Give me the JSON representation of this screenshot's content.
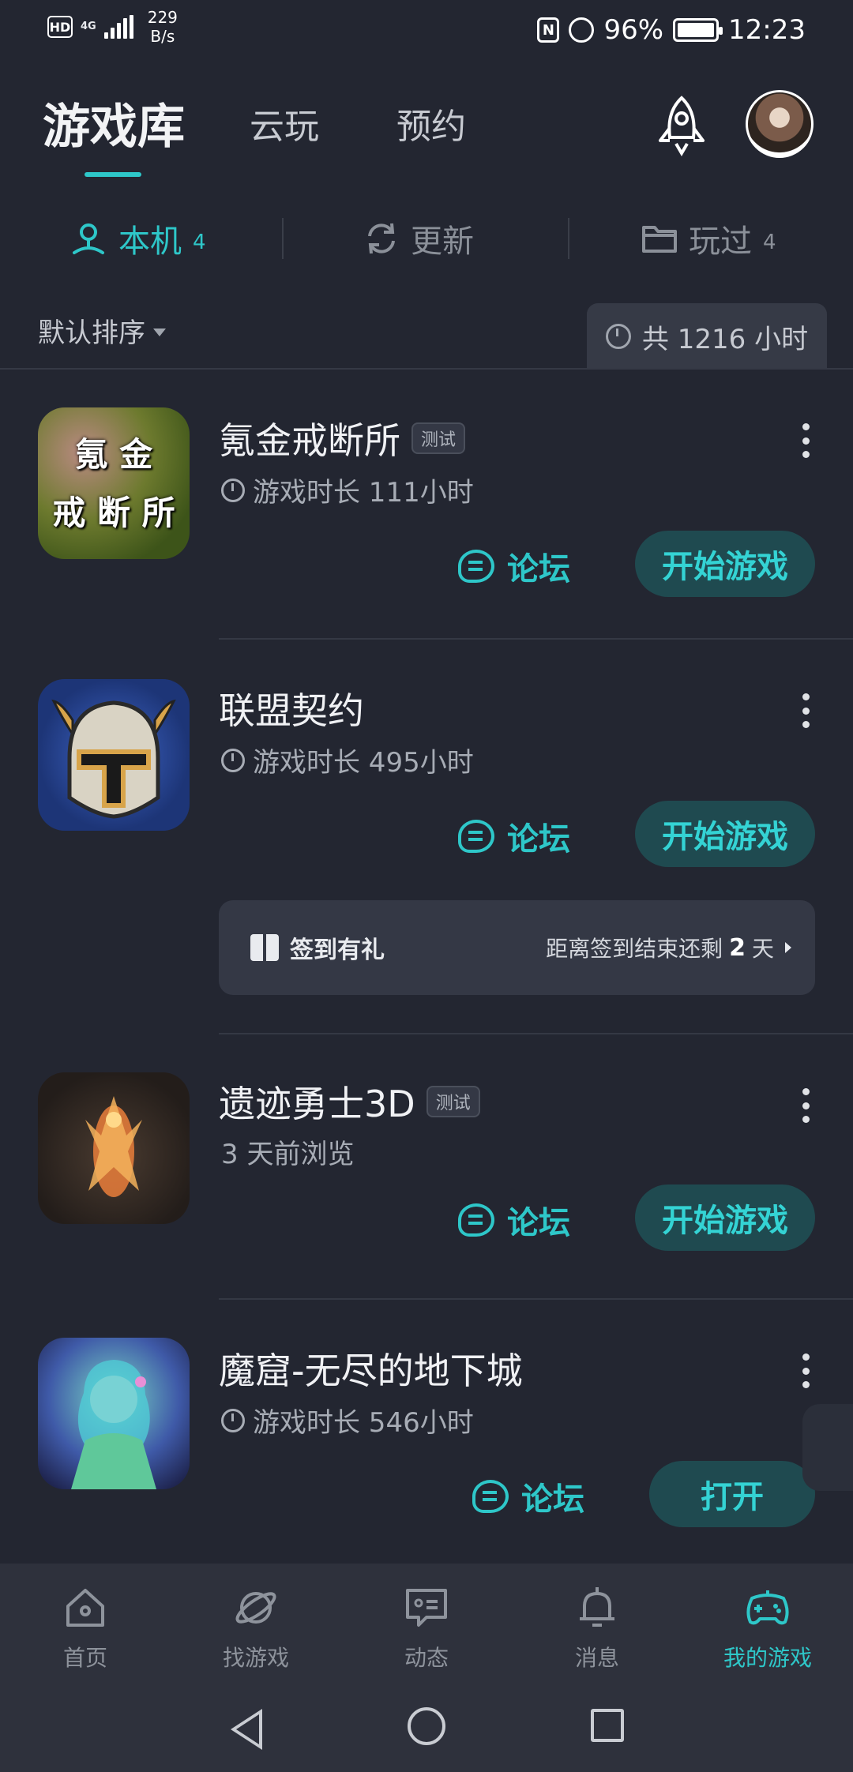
{
  "status_bar": {
    "hd": "HD",
    "network": "4G",
    "net_rate_value": "229",
    "net_rate_unit": "B/s",
    "battery": "96%",
    "time": "12:23"
  },
  "header": {
    "tabs": [
      {
        "label": "游戏库",
        "active": true
      },
      {
        "label": "云玩",
        "active": false
      },
      {
        "label": "预约",
        "active": false
      }
    ],
    "accent_color": "#2ec7c9"
  },
  "subtabs": [
    {
      "label": "本机",
      "count": "4",
      "active": true,
      "icon": "location-pin-icon"
    },
    {
      "label": "更新",
      "count": "",
      "active": false,
      "icon": "refresh-icon"
    },
    {
      "label": "玩过",
      "count": "4",
      "active": false,
      "icon": "folder-icon"
    }
  ],
  "sort": {
    "label": "默认排序"
  },
  "total_time": {
    "label": "共 1216 小时"
  },
  "games": [
    {
      "name": "氪金戒断所",
      "badge": "测试",
      "sub": "游戏时长 111小时",
      "forum": "论坛",
      "action": "开始游戏",
      "icon_text_1": "氪 金",
      "icon_text_2": "戒 断 所"
    },
    {
      "name": "联盟契约",
      "badge": "",
      "sub": "游戏时长 495小时",
      "forum": "论坛",
      "action": "开始游戏"
    },
    {
      "name": "遗迹勇士3D",
      "badge": "测试",
      "sub": "3 天前浏览",
      "forum": "论坛",
      "action": "开始游戏"
    },
    {
      "name": "魔窟-无尽的地下城",
      "badge": "",
      "sub": "游戏时长 546小时",
      "forum": "论坛",
      "action": "打开"
    }
  ],
  "gift_card": {
    "title": "签到有礼",
    "remaining_prefix": "距离签到结束还剩",
    "remaining_days": "2",
    "remaining_suffix": "天"
  },
  "bottom_nav": [
    {
      "label": "首页",
      "icon": "home-icon",
      "active": false
    },
    {
      "label": "找游戏",
      "icon": "planet-icon",
      "active": false
    },
    {
      "label": "动态",
      "icon": "chat-icon",
      "active": false
    },
    {
      "label": "消息",
      "icon": "bell-icon",
      "active": false
    },
    {
      "label": "我的游戏",
      "icon": "gamepad-icon",
      "active": true
    }
  ]
}
